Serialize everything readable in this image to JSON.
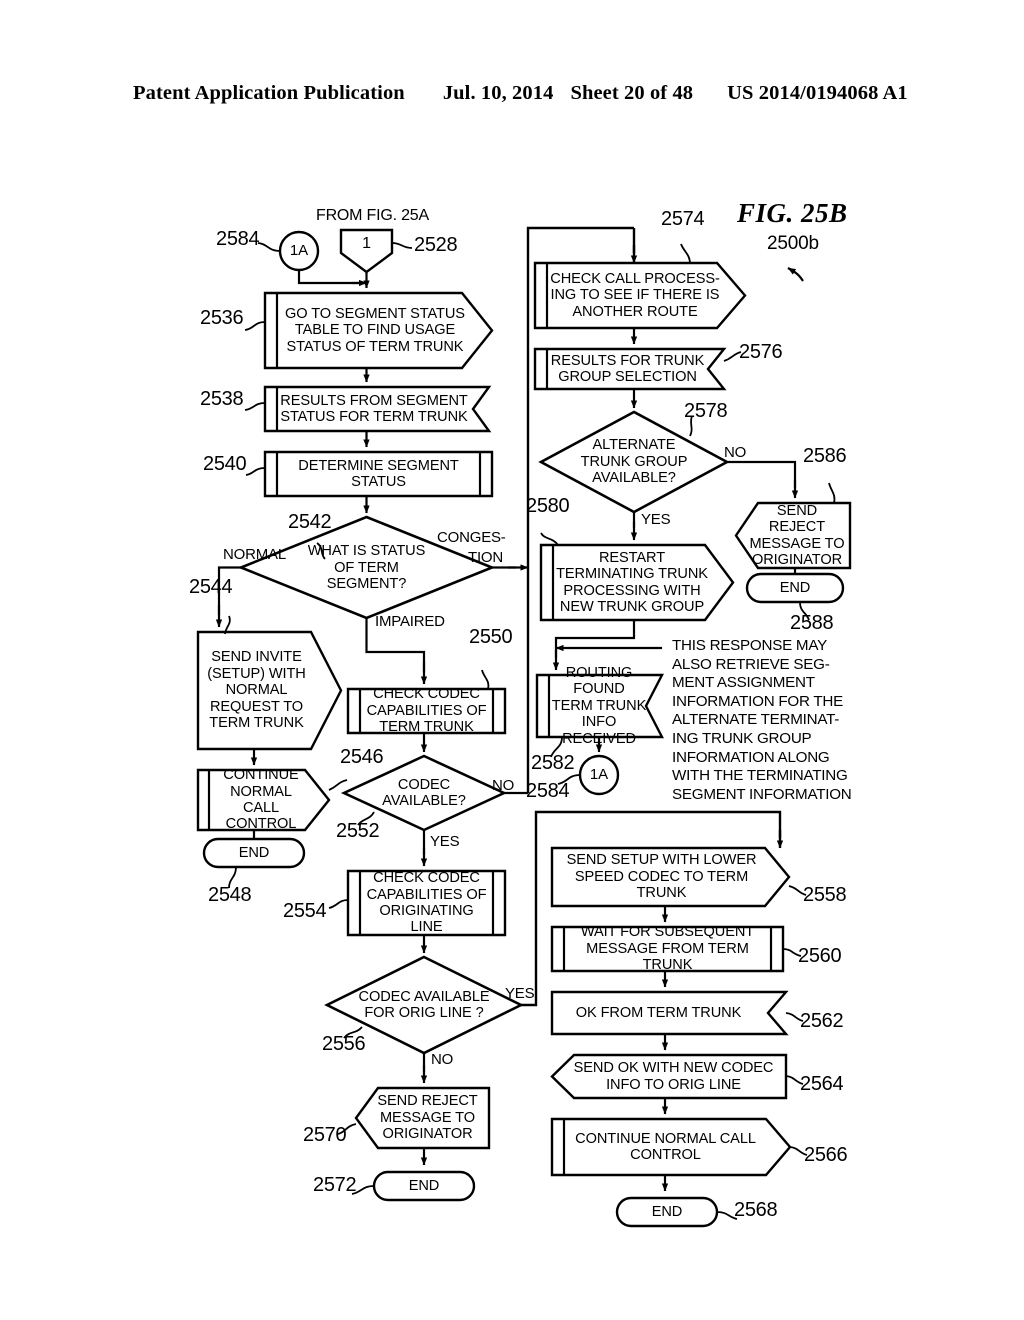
{
  "header": {
    "publication": "Patent Application Publication",
    "date": "Jul. 10, 2014",
    "sheet": "Sheet 20 of 48",
    "docnum": "US 2014/0194068 A1"
  },
  "figure": {
    "title": "FIG. 25B",
    "subtitle": "2500b",
    "from_fig": "FROM FIG. 25A",
    "note": "THIS RESPONSE MAY\nALSO RETRIEVE SEG-\nMENT ASSIGNMENT\nINFORMATION FOR THE\nALTERNATE TERMINAT-\nING TRUNK GROUP\nINFORMATION ALONG\nWITH THE TERMINATING\nSEGMENT INFORMATION"
  },
  "nodes": {
    "n2528": {
      "ref": "2528",
      "text": "1"
    },
    "n2584a": {
      "ref": "2584",
      "text": "1A"
    },
    "n2536": {
      "ref": "2536",
      "text": "GO TO SEGMENT STATUS TABLE TO FIND USAGE STATUS OF TERM TRUNK"
    },
    "n2538": {
      "ref": "2538",
      "text": "RESULTS FROM SEGMENT STATUS FOR TERM TRUNK"
    },
    "n2540": {
      "ref": "2540",
      "text": "DETERMINE SEGMENT STATUS"
    },
    "n2542": {
      "ref": "2542",
      "text": "WHAT IS STATUS OF TERM SEGMENT?"
    },
    "n2544": {
      "ref": "2544",
      "text": "SEND INVITE (SETUP) WITH NORMAL REQUEST TO TERM TRUNK"
    },
    "n2546": {
      "ref": "2546",
      "text": "CONTINUE NORMAL CALL CONTROL"
    },
    "n2548": {
      "ref": "2548",
      "text": "END"
    },
    "n2550": {
      "ref": "2550",
      "text": "CHECK CODEC CAPABILITIES OF TERM TRUNK"
    },
    "n2552": {
      "ref": "2552",
      "text": "CODEC AVAILABLE?"
    },
    "n2554": {
      "ref": "2554",
      "text": "CHECK CODEC CAPABILITIES OF ORIGINATING LINE"
    },
    "n2556": {
      "ref": "2556",
      "text": "CODEC AVAILABLE FOR ORIG LINE ?"
    },
    "n2570": {
      "ref": "2570",
      "text": "SEND REJECT MESSAGE TO ORIGINATOR"
    },
    "n2572": {
      "ref": "2572",
      "text": "END"
    },
    "n2574": {
      "ref": "2574",
      "text": "CHECK CALL PROCESS- ING TO SEE IF THERE IS ANOTHER ROUTE"
    },
    "n2576": {
      "ref": "2576",
      "text": "RESULTS FOR TRUNK GROUP SELECTION"
    },
    "n2578": {
      "ref": "2578",
      "text": "ALTERNATE TRUNK GROUP AVAILABLE?"
    },
    "n2580": {
      "ref": "2580",
      "text": "RESTART TERMINATING TRUNK PROCESSING WITH NEW TRUNK GROUP"
    },
    "n2582": {
      "ref": "2582",
      "text": "ROUTING FOUND TERM TRUNK INFO RECEIVED"
    },
    "n2584b": {
      "ref": "2584",
      "text": "1A"
    },
    "n2586": {
      "ref": "2586",
      "text": "SEND REJECT MESSAGE TO ORIGINATOR"
    },
    "n2588": {
      "ref": "2588",
      "text": "END"
    },
    "n2558": {
      "ref": "2558",
      "text": "SEND SETUP WITH LOWER SPEED CODEC TO TERM TRUNK"
    },
    "n2560": {
      "ref": "2560",
      "text": "WAIT FOR SUBSEQUENT MESSAGE FROM TERM TRUNK"
    },
    "n2562": {
      "ref": "2562",
      "text": "OK FROM TERM TRUNK"
    },
    "n2564": {
      "ref": "2564",
      "text": "SEND OK WITH NEW CODEC INFO TO ORIG LINE"
    },
    "n2566": {
      "ref": "2566",
      "text": "CONTINUE NORMAL CALL CONTROL"
    },
    "n2568": {
      "ref": "2568",
      "text": "END"
    }
  },
  "edge_labels": {
    "normal": "NORMAL",
    "congestion_1": "CONGES-",
    "congestion_2": "TION",
    "impaired": "IMPAIRED",
    "yes_2552": "YES",
    "no_2552": "NO",
    "yes_2556": "YES",
    "no_2556": "NO",
    "yes_2578": "YES",
    "no_2578": "NO"
  },
  "colors": {
    "ink": "#000000",
    "paper": "#ffffff"
  }
}
